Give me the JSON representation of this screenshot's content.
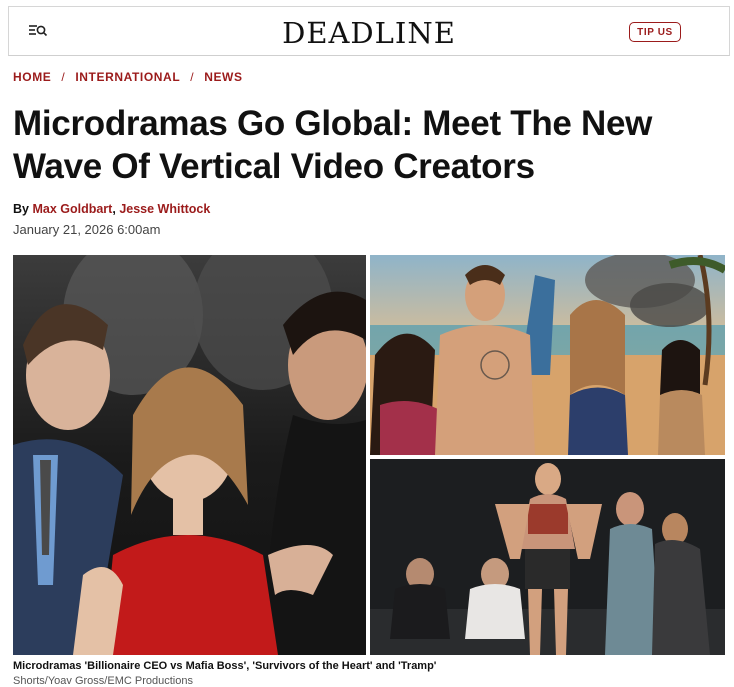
{
  "header": {
    "logo": "DEADLINE",
    "tip_label": "TIP US",
    "menu_icon": "menu-search-icon"
  },
  "breadcrumb": [
    "HOME",
    "INTERNATIONAL",
    "NEWS"
  ],
  "article": {
    "headline": "Microdramas Go Global: Meet The New Wave Of Vertical Video Creators",
    "by_prefix": "By",
    "authors": [
      "Max Goldbart",
      "Jesse Whittock"
    ],
    "author_separator": ",",
    "date": "January 21, 2026 6:00am"
  },
  "hero": {
    "caption": "Microdramas 'Billionaire CEO vs Mafia Boss', 'Survivors of the Heart' and 'Tramp'",
    "credit": "Shorts/Yoav Gross/EMC Productions"
  },
  "colors": {
    "accent": "#9b1b1b",
    "text": "#111111"
  }
}
